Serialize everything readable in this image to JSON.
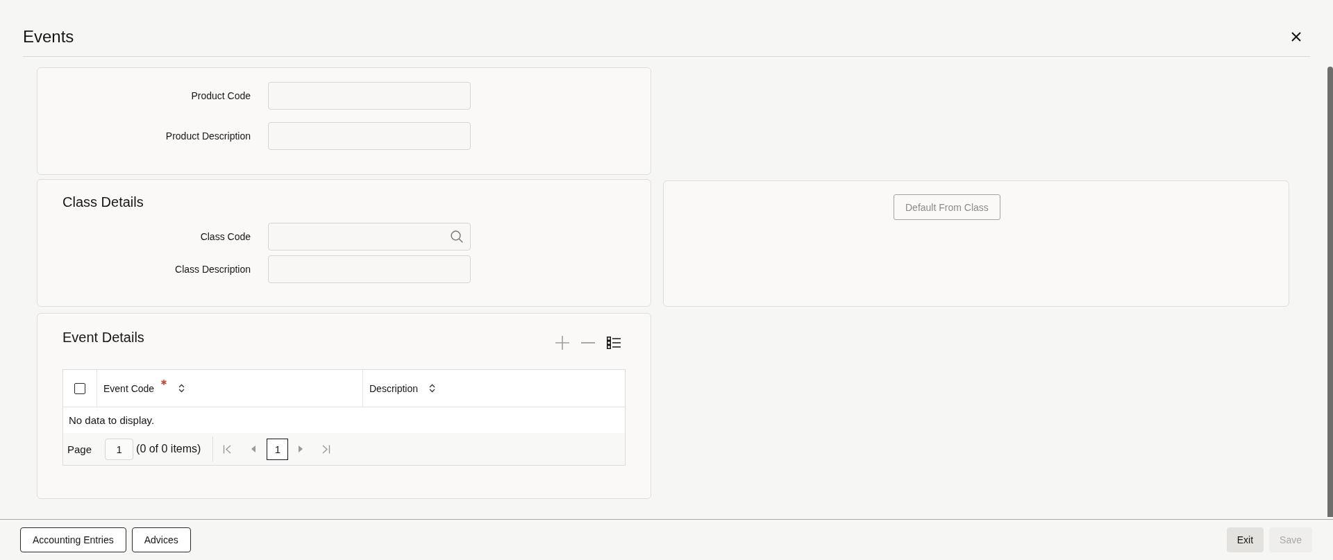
{
  "window": {
    "title": "Events"
  },
  "product_panel": {
    "fields": [
      {
        "label": "Product Code",
        "kind": "text"
      },
      {
        "label": "Product Description",
        "kind": "text"
      }
    ]
  },
  "class_details": {
    "title": "Class Details",
    "fields": [
      {
        "label": "Class Code",
        "kind": "lookup"
      },
      {
        "label": "Class Description",
        "kind": "text"
      }
    ]
  },
  "class_actions": {
    "buttons": [
      {
        "label": "Default From Class",
        "disabled": true
      }
    ]
  },
  "event_details": {
    "title": "Event Details",
    "actions": [
      {
        "kind": "add",
        "disabled": true
      },
      {
        "kind": "remove",
        "disabled": true
      },
      {
        "kind": "columns",
        "disabled": false
      }
    ],
    "table": {
      "select_all": {
        "checked": false
      },
      "columns": [
        {
          "label": "Event Code",
          "required": true,
          "sortable": true
        },
        {
          "label": "Description",
          "required": false,
          "sortable": true
        }
      ],
      "empty_message": "No data to display.",
      "pagination": {
        "label": "Page",
        "page_input": "1",
        "summary": "(0 of 0 items)",
        "nav": [
          {
            "kind": "first",
            "disabled": true
          },
          {
            "kind": "previous",
            "disabled": true
          },
          {
            "kind": "page",
            "label": "1",
            "selected": true
          },
          {
            "kind": "next",
            "disabled": true
          },
          {
            "kind": "last",
            "disabled": true
          }
        ]
      }
    }
  },
  "footer": {
    "left_buttons": [
      {
        "label": "Accounting Entries"
      },
      {
        "label": "Advices"
      }
    ],
    "right_buttons": [
      {
        "label": "Exit",
        "disabled": false
      },
      {
        "label": "Save",
        "disabled": true
      }
    ]
  }
}
